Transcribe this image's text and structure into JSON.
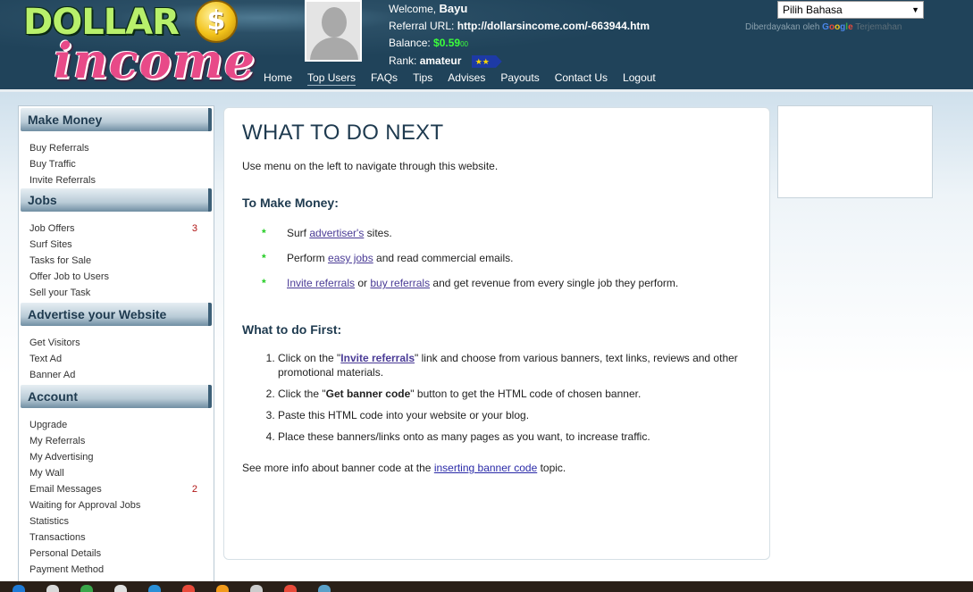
{
  "logo": {
    "word1": "DOLLAR",
    "coin": "$",
    "word2": "income"
  },
  "user": {
    "welcome_label": "Welcome,",
    "name": "Bayu",
    "referral_label": "Referral URL:",
    "referral_url": "http://dollarsincome.com/-663944.htm",
    "balance_label": "Balance:",
    "balance_value": "$0.59",
    "balance_sub": "00",
    "rank_label": "Rank:",
    "rank_value": "amateur",
    "rank_badge": "★★"
  },
  "nav": {
    "home": "Home",
    "top_users": "Top Users",
    "faqs": "FAQs",
    "tips": "Tips",
    "advises": "Advises",
    "payouts": "Payouts",
    "contact_us": "Contact Us",
    "logout": "Logout"
  },
  "language": {
    "selected": "Pilih Bahasa",
    "arrow": "▼",
    "powered_by": "Diberdayakan oleh",
    "google": "Google",
    "translate": "Terjemahan"
  },
  "sidebar": {
    "make_money": {
      "title": "Make Money",
      "items": [
        "Buy Referrals",
        "Buy Traffic",
        "Invite Referrals"
      ]
    },
    "jobs": {
      "title": "Jobs",
      "items": [
        {
          "label": "Job Offers",
          "count": "3"
        },
        {
          "label": "Surf Sites",
          "count": ""
        },
        {
          "label": "Tasks for Sale",
          "count": ""
        },
        {
          "label": "Offer Job to Users",
          "count": ""
        },
        {
          "label": "Sell your Task",
          "count": ""
        }
      ]
    },
    "advertise": {
      "title": "Advertise your Website",
      "items": [
        "Get Visitors",
        "Text Ad",
        "Banner Ad"
      ]
    },
    "account": {
      "title": "Account",
      "items": [
        {
          "label": "Upgrade",
          "count": ""
        },
        {
          "label": "My Referrals",
          "count": ""
        },
        {
          "label": "My Advertising",
          "count": ""
        },
        {
          "label": "My Wall",
          "count": ""
        },
        {
          "label": "Email Messages",
          "count": "2"
        },
        {
          "label": "Waiting for Approval Jobs",
          "count": ""
        },
        {
          "label": "Statistics",
          "count": ""
        },
        {
          "label": "Transactions",
          "count": ""
        },
        {
          "label": "Personal Details",
          "count": ""
        },
        {
          "label": "Payment Method",
          "count": ""
        },
        {
          "label": "Notifications",
          "count": ""
        }
      ]
    }
  },
  "main": {
    "title": "WHAT TO DO NEXT",
    "intro": "Use menu on the left to navigate through this website.",
    "money_title": "To Make Money:",
    "bullet": "*",
    "money1": {
      "pre": "Surf ",
      "link": "advertiser's",
      "post": " sites."
    },
    "money2": {
      "pre": "Perform ",
      "link": "easy jobs",
      "post": " and read commercial emails."
    },
    "money3": {
      "link1": "Invite referrals",
      "mid": " or ",
      "link2": "buy referrals",
      "post": " and get revenue from every single job they perform."
    },
    "first_title": "What to do First:",
    "step1": {
      "pre": "Click on the \"",
      "link": "Invite referrals",
      "post": "\" link and choose from various banners, text links, reviews and other promotional materials."
    },
    "step2": {
      "pre": "Click the \"",
      "bold": "Get banner code",
      "post": "\" button to get the HTML code of chosen banner."
    },
    "step3": "Paste this HTML code into your website or your blog.",
    "step4": "Place these banners/links onto as many pages as you want, to increase traffic.",
    "see_more": {
      "pre": "See more info about banner code at the ",
      "link": "inserting banner code",
      "post": " topic."
    }
  },
  "colors": {
    "header_bg": "#20435a",
    "accent_green": "#3bff3b",
    "link": "#4a3b96",
    "count_red": "#b01414",
    "heading": "#1e3a4f"
  }
}
